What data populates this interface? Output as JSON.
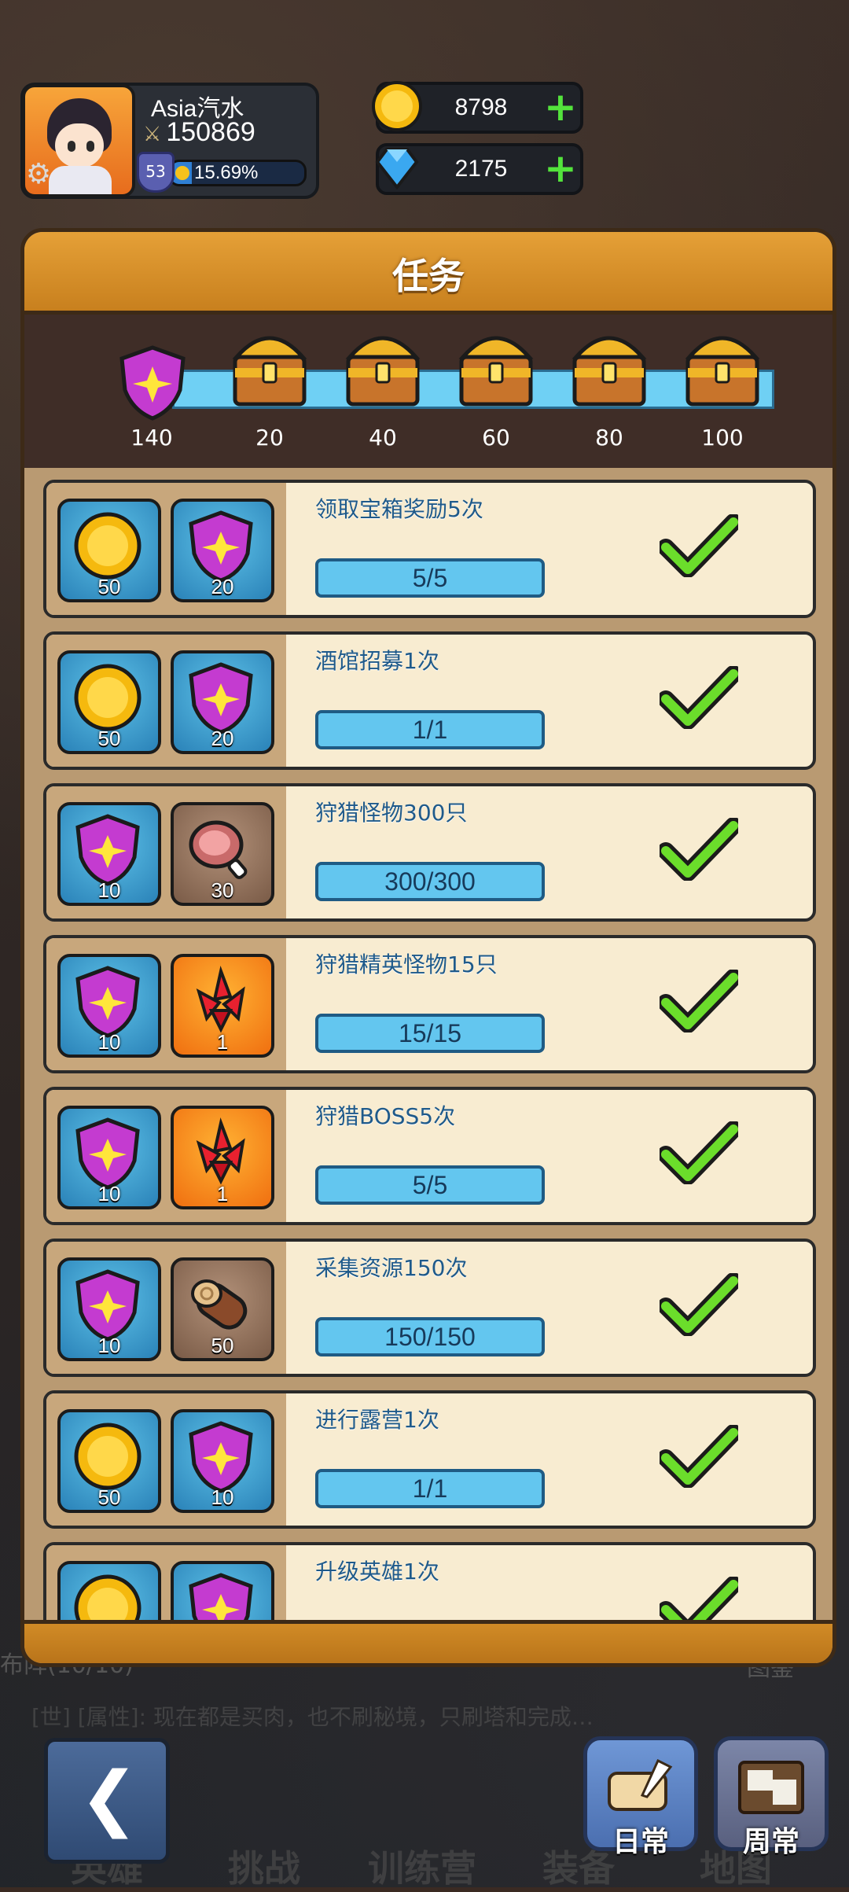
{
  "player": {
    "name": "Asia汽水",
    "power": "150869",
    "level": "53",
    "xp_percent_text": "15.69%",
    "xp_fraction": 0.1569
  },
  "resources": {
    "gold": "8798",
    "diamond": "2175"
  },
  "panel": {
    "title": "任务",
    "activity_points": "140",
    "milestones": [
      "20",
      "40",
      "60",
      "80",
      "100"
    ]
  },
  "tasks": [
    {
      "title": "领取宝箱奖励5次",
      "progress": "5/5",
      "rewards": [
        {
          "icon": "gold-coin",
          "count": "50"
        },
        {
          "icon": "activity-gem",
          "count": "20"
        }
      ]
    },
    {
      "title": "酒馆招募1次",
      "progress": "1/1",
      "rewards": [
        {
          "icon": "gold-coin",
          "count": "50"
        },
        {
          "icon": "activity-gem",
          "count": "20"
        }
      ]
    },
    {
      "title": "狩猎怪物300只",
      "progress": "300/300",
      "rewards": [
        {
          "icon": "activity-gem",
          "count": "10"
        },
        {
          "icon": "meat",
          "count": "30"
        }
      ]
    },
    {
      "title": "狩猎精英怪物15只",
      "progress": "15/15",
      "rewards": [
        {
          "icon": "activity-gem",
          "count": "10"
        },
        {
          "icon": "red-crystal",
          "count": "1"
        }
      ]
    },
    {
      "title": "狩猎BOSS5次",
      "progress": "5/5",
      "rewards": [
        {
          "icon": "activity-gem",
          "count": "10"
        },
        {
          "icon": "red-crystal",
          "count": "1"
        }
      ]
    },
    {
      "title": "采集资源150次",
      "progress": "150/150",
      "rewards": [
        {
          "icon": "activity-gem",
          "count": "10"
        },
        {
          "icon": "wood-log",
          "count": "50"
        }
      ]
    },
    {
      "title": "进行露营1次",
      "progress": "1/1",
      "rewards": [
        {
          "icon": "gold-coin",
          "count": "50"
        },
        {
          "icon": "activity-gem",
          "count": "10"
        }
      ]
    },
    {
      "title": "升级英雄1次",
      "progress": "",
      "rewards": [
        {
          "icon": "gold-coin",
          "count": ""
        },
        {
          "icon": "activity-gem",
          "count": ""
        }
      ]
    }
  ],
  "background": {
    "chat": "[世] [属性]: 现在都是买肉，也不刷秘境，只刷塔和完成…",
    "left_text": "布阵(10/10)",
    "right_text": "图鉴",
    "nav": [
      "英雄",
      "挑战",
      "训练营",
      "装备",
      "地图"
    ]
  },
  "buttons": {
    "daily": "日常",
    "weekly": "周常"
  }
}
